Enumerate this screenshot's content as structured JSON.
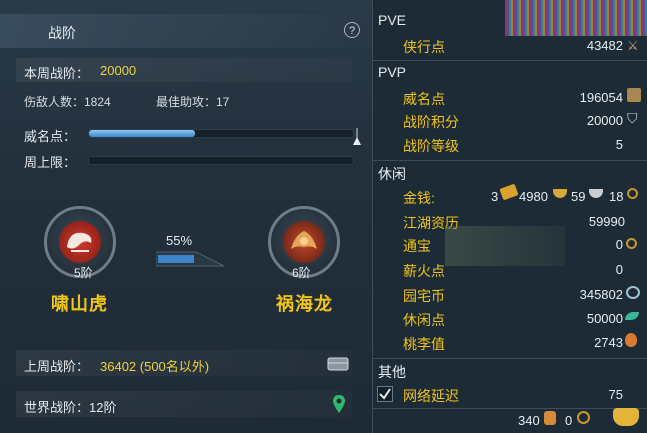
{
  "left": {
    "title": "战阶",
    "help": "?",
    "week_rank_label": "本周战阶：",
    "week_rank_value": "20000",
    "kills_label": "伤敌人数：1824",
    "assists_label": "最佳助攻：17",
    "prestige_label": "威名点：",
    "week_cap_label": "周上限：",
    "prestige_progress": 0.4,
    "week_cap_progress": 0.0,
    "current_rank": {
      "name": "啸山虎",
      "level": "5阶"
    },
    "next_rank": {
      "name": "祸海龙",
      "level": "6阶"
    },
    "progress_percent": "55%",
    "last_week_label": "上周战阶：",
    "last_week_value": "36402 (500名以外)",
    "world_rank_label": "世界战阶：12阶"
  },
  "right": {
    "pve_header": "PVE",
    "pve_items": [
      {
        "label": "侠行点",
        "value": "43482"
      }
    ],
    "pvp_header": "PVP",
    "pvp_items": [
      {
        "label": "威名点",
        "value": "196054"
      },
      {
        "label": "战阶积分",
        "value": "20000"
      },
      {
        "label": "战阶等级",
        "value": "5"
      }
    ],
    "leisure_header": "休闲",
    "money_label": "金钱:",
    "money_gold": "3",
    "money_silver_a": "4980",
    "money_silver_b": "59",
    "money_copper": "18",
    "leisure_items": [
      {
        "label": "江湖资历",
        "value": "59990"
      },
      {
        "label": "通宝",
        "value": "0"
      },
      {
        "label": "薪火点",
        "value": "0"
      },
      {
        "label": "园宅币",
        "value": "345802"
      },
      {
        "label": "休闲点",
        "value": "50000"
      },
      {
        "label": "桃李值",
        "value": "2743"
      }
    ],
    "other_header": "其他",
    "network_label": "网络延迟",
    "network_value": "75",
    "footer_a": "340",
    "footer_b": "0"
  },
  "colors": {
    "accent_yellow": "#f0c419",
    "bar_blue": "#3a86c8"
  }
}
